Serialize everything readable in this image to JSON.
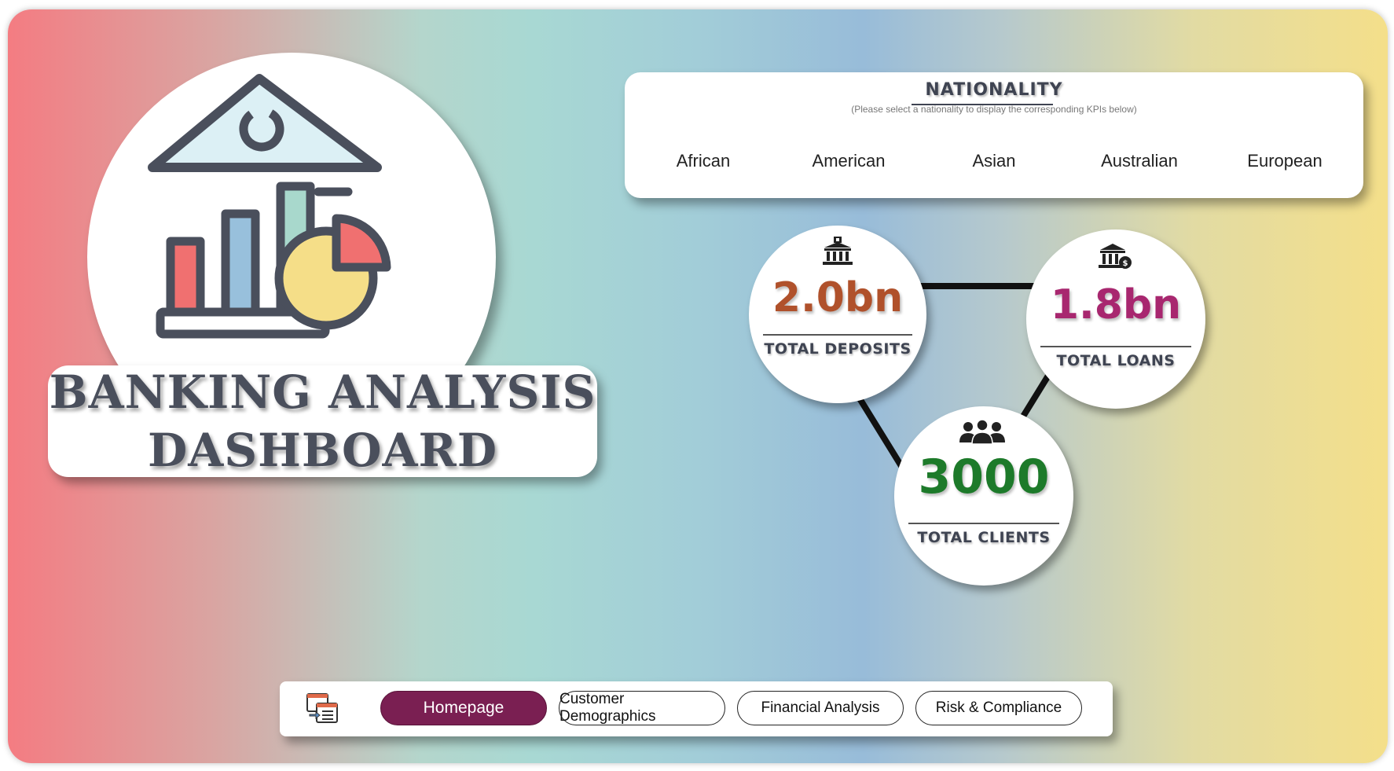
{
  "dashboard": {
    "title_line1": "BANKING ANALYSIS",
    "title_line2": "DASHBOARD"
  },
  "nationality": {
    "title": "NATIONALITY",
    "subtitle": "(Please select a nationality to display the corresponding KPIs below)",
    "options": [
      "African",
      "American",
      "Asian",
      "Australian",
      "European"
    ]
  },
  "kpis": {
    "deposits": {
      "value": "2.0bn",
      "label": "TOTAL DEPOSITS",
      "color": "#b0512b",
      "icon": "bank-icon"
    },
    "loans": {
      "value": "1.8bn",
      "label": "TOTAL LOANS",
      "color": "#a8276f",
      "icon": "bank-money-icon"
    },
    "clients": {
      "value": "3000",
      "label": "TOTAL CLIENTS",
      "color": "#1d7a2a",
      "icon": "people-icon"
    }
  },
  "nav": {
    "icon": "page-navigator-icon",
    "buttons": [
      "Homepage",
      "Customer Demographics",
      "Financial Analysis",
      "Risk & Compliance"
    ],
    "active": "Homepage",
    "active_color": "#7a1f52"
  },
  "logo": {
    "icon": "bank-analytics-icon",
    "colors": {
      "outline": "#4a4f5c",
      "roof": "#dcf0f5",
      "bar1": "#f07070",
      "bar2": "#98c0dc",
      "bar3": "#a8d8cc",
      "pie": "#f5de88",
      "slice": "#f07070"
    }
  }
}
